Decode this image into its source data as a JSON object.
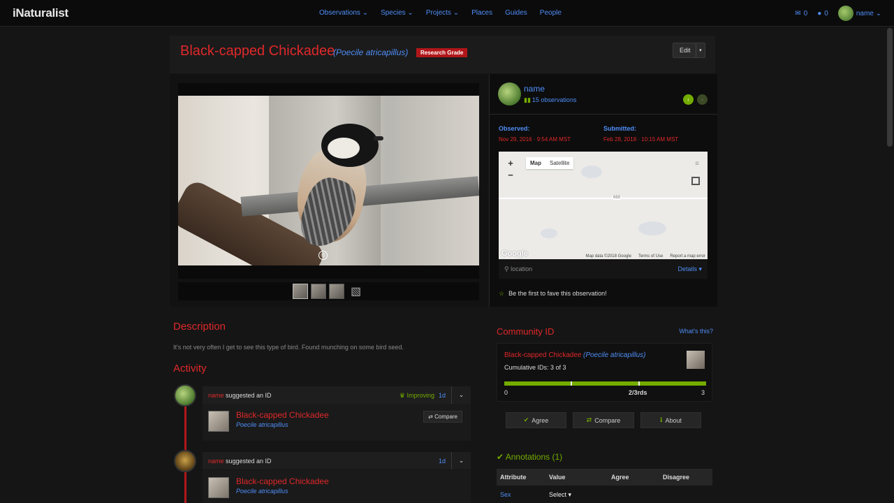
{
  "nav": {
    "logo": "iNaturalist",
    "links": [
      "Observations ⌄",
      "Species ⌄",
      "Projects ⌄",
      "Places",
      "Guides",
      "People"
    ],
    "messages_count": "0",
    "notifications_count": "0",
    "username": "name ⌄"
  },
  "observation": {
    "common_name": "Black-capped Chickadee",
    "scientific_name": "(Poecile atricapillus)",
    "grade": "Research Grade",
    "edit_label": "Edit",
    "edit_caret": "▾"
  },
  "photo": {
    "license_icon": "©",
    "add_photo_icon": "▧"
  },
  "observer": {
    "name": "name",
    "observation_count": "15 observations",
    "prev_arrow": "‹",
    "next_arrow": "›"
  },
  "dates": {
    "observed_label": "Observed:",
    "observed_value": "Nov 29, 2016 · 9:54 AM MST",
    "submitted_label": "Submitted:",
    "submitted_value": "Feb 28, 2018 · 10:15 AM MST"
  },
  "map": {
    "zoom_in": "+",
    "zoom_out": "−",
    "type_map": "Map",
    "type_satellite": "Satellite",
    "road_shield": "669",
    "google_logo": "Google",
    "attribution": [
      "Map data ©2018 Google",
      "Terms of Use",
      "Report a map error"
    ],
    "location_label": "location",
    "details_label": "Details ▾"
  },
  "fave": {
    "text": "Be the first to fave this observation!"
  },
  "description": {
    "title": "Description",
    "text": "It's not very often I get to see this type of bird. Found munching on some bird seed."
  },
  "activity": {
    "title": "Activity",
    "items": [
      {
        "user": "name",
        "action": " suggested an ID",
        "status": "Improving",
        "age": "1d",
        "taxon_common": "Black-capped Chickadee",
        "taxon_sci": "Poecile atricapillus",
        "compare_label": "⇄ Compare",
        "caret": "⌄"
      },
      {
        "user": "name",
        "action": " suggested an ID",
        "status": "",
        "age": "1d",
        "taxon_common": "Black-capped Chickadee",
        "taxon_sci": "Poecile atricapillus",
        "compare_label": "",
        "caret": "⌄"
      }
    ]
  },
  "community_id": {
    "title": "Community ID",
    "whats_this": "What's this?",
    "common_name": "Black-capped Chickadee",
    "scientific_name": "(Poecile atricapillus)",
    "cumulative": "Cumulative IDs: 3 of 3",
    "agreement_fraction": 1.0,
    "scale_min": "0",
    "scale_mid": "2/3rds",
    "scale_max": "3",
    "agree_label": "Agree",
    "compare_label": "Compare",
    "about_label": "About"
  },
  "annotations": {
    "title": "Annotations (1)",
    "columns": [
      "Attribute",
      "Value",
      "Agree",
      "Disagree"
    ],
    "rows": [
      {
        "attribute": "Sex",
        "value": "Select ▾"
      }
    ]
  },
  "colors": {
    "accent_red": "#e0282a",
    "link_blue": "#4f8ef7",
    "inat_green": "#74ac00"
  }
}
